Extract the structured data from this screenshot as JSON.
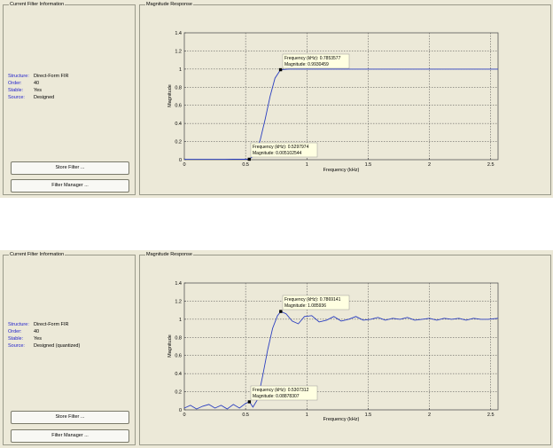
{
  "panels": [
    {
      "filter_info": {
        "title": "Current Filter Information",
        "rows": [
          {
            "key": "Structure:",
            "value": "Direct-Form FIR"
          },
          {
            "key": "Order:",
            "value": "40"
          },
          {
            "key": "Stable:",
            "value": "Yes"
          },
          {
            "key": "Source:",
            "value": "Designed"
          }
        ],
        "store_label": "Store Filter ...",
        "manager_label": "Filter Manager ..."
      },
      "magnitude": {
        "title": "Magnitude Response",
        "tip_high": {
          "line1": "Frequency (kHz): 0.7853577",
          "line2": "Magnitude: 0.9930459"
        },
        "tip_low": {
          "line1": "Frequency (kHz): 0.5297974",
          "line2": "Magnitude: 0.005102544"
        }
      }
    },
    {
      "filter_info": {
        "title": "Current Filter Information",
        "rows": [
          {
            "key": "Structure:",
            "value": "Direct-Form FIR"
          },
          {
            "key": "Order:",
            "value": "40"
          },
          {
            "key": "Stable:",
            "value": "Yes"
          },
          {
            "key": "Source:",
            "value": "Designed (quantized)"
          }
        ],
        "store_label": "Store Filter ...",
        "manager_label": "Filter Manager ..."
      },
      "magnitude": {
        "title": "Magnitude Response",
        "tip_high": {
          "line1": "Frequency (kHz): 0.7869141",
          "line2": "Magnitude: 1.085936"
        },
        "tip_low": {
          "line1": "Frequency (kHz): 0.5307312",
          "line2": "Magnitude: 0.08878307"
        }
      }
    }
  ],
  "chart_data": [
    {
      "type": "line",
      "xlabel": "Frequency (kHz)",
      "ylabel": "Magnitude",
      "xlim": [
        0,
        2.56
      ],
      "ylim": [
        0,
        1.4
      ],
      "xticks": [
        "0",
        "0.5",
        "1",
        "1.5",
        "2",
        "2.5"
      ],
      "yticks": [
        "0",
        "0.2",
        "0.4",
        "0.6",
        "0.8",
        "1",
        "1.2",
        "1.4"
      ],
      "grid": true,
      "color": "#2b3fc0",
      "series": [
        {
          "x": [
            0,
            0.2,
            0.4,
            0.53,
            0.58,
            0.62,
            0.66,
            0.7,
            0.74,
            0.785,
            0.85,
            1.0,
            1.5,
            2.0,
            2.56
          ],
          "values": [
            0.004,
            0.004,
            0.005,
            0.005,
            0.06,
            0.22,
            0.45,
            0.7,
            0.9,
            0.993,
            1.0,
            1.0,
            1.0,
            1.0,
            1.0
          ]
        }
      ],
      "markers": [
        {
          "x": 0.7853577,
          "y": 0.9930459
        },
        {
          "x": 0.5297974,
          "y": 0.005102544
        }
      ]
    },
    {
      "type": "line",
      "xlabel": "Frequency (kHz)",
      "ylabel": "Magnitude",
      "xlim": [
        0,
        2.56
      ],
      "ylim": [
        0,
        1.4
      ],
      "xticks": [
        "0",
        "0.5",
        "1",
        "1.5",
        "2",
        "2.5"
      ],
      "yticks": [
        "0",
        "0.2",
        "0.4",
        "0.6",
        "0.8",
        "1",
        "1.2",
        "1.4"
      ],
      "grid": true,
      "color": "#2b3fc0",
      "series": [
        {
          "x": [
            0,
            0.05,
            0.1,
            0.15,
            0.2,
            0.25,
            0.3,
            0.35,
            0.4,
            0.45,
            0.5,
            0.531,
            0.56,
            0.6,
            0.64,
            0.68,
            0.72,
            0.76,
            0.787,
            0.83,
            0.88,
            0.93,
            0.98,
            1.04,
            1.1,
            1.16,
            1.22,
            1.28,
            1.34,
            1.4,
            1.46,
            1.52,
            1.58,
            1.64,
            1.7,
            1.76,
            1.82,
            1.88,
            1.94,
            2.0,
            2.06,
            2.12,
            2.18,
            2.24,
            2.3,
            2.36,
            2.42,
            2.48,
            2.56
          ],
          "values": [
            0.02,
            0.05,
            0.01,
            0.04,
            0.06,
            0.02,
            0.05,
            0.01,
            0.06,
            0.02,
            0.07,
            0.089,
            0.03,
            0.12,
            0.38,
            0.66,
            0.9,
            1.04,
            1.086,
            1.06,
            0.98,
            0.95,
            1.03,
            1.04,
            0.97,
            0.99,
            1.03,
            0.98,
            1.0,
            1.03,
            0.99,
            1.0,
            1.02,
            0.99,
            1.01,
            1.0,
            1.02,
            0.99,
            1.0,
            1.01,
            0.99,
            1.01,
            1.0,
            1.01,
            0.99,
            1.01,
            1.0,
            1.0,
            1.01
          ]
        }
      ],
      "markers": [
        {
          "x": 0.7869141,
          "y": 1.085936
        },
        {
          "x": 0.5307312,
          "y": 0.08878307
        }
      ]
    }
  ]
}
